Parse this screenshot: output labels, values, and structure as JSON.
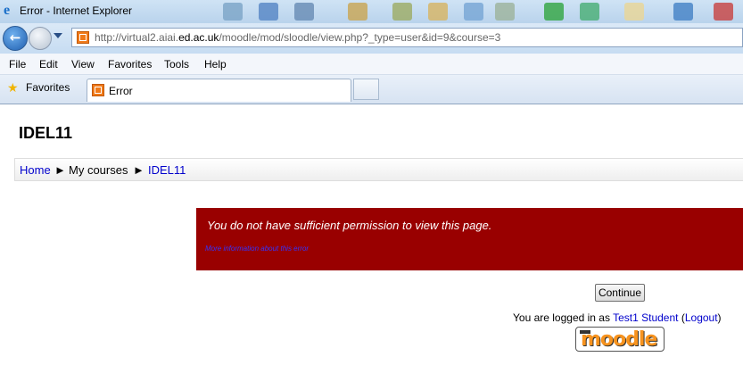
{
  "window": {
    "title": "Error - Internet Explorer",
    "icon": "internet-explorer-icon"
  },
  "address_bar": {
    "url_prefix": "http://virtual2.aiai.",
    "url_domain": "ed.ac.uk",
    "url_path": "/moodle/mod/sloodle/view.php?_type=user&id=9&course=3"
  },
  "menu": [
    "File",
    "Edit",
    "View",
    "Favorites",
    "Tools",
    "Help"
  ],
  "favorites_label": "Favorites",
  "tab": {
    "label": "Error"
  },
  "page": {
    "course_title": "IDEL11",
    "breadcrumb": {
      "home": "Home",
      "sep1": "►",
      "my_courses": "My courses",
      "sep2": "►",
      "course": "IDEL11"
    },
    "error": {
      "message": "You do not have sufficient permission to view this page.",
      "more_info": "More information about this error"
    },
    "continue_label": "Continue",
    "login": {
      "prefix": "You are logged in as ",
      "user": "Test1 Student",
      "logout_open": " (",
      "logout": "Logout",
      "logout_close": ")"
    },
    "logo_text": "moodle"
  },
  "colors": {
    "error_bg": "#990000",
    "link": "#0000cc",
    "moodle_orange": "#f7931e"
  }
}
